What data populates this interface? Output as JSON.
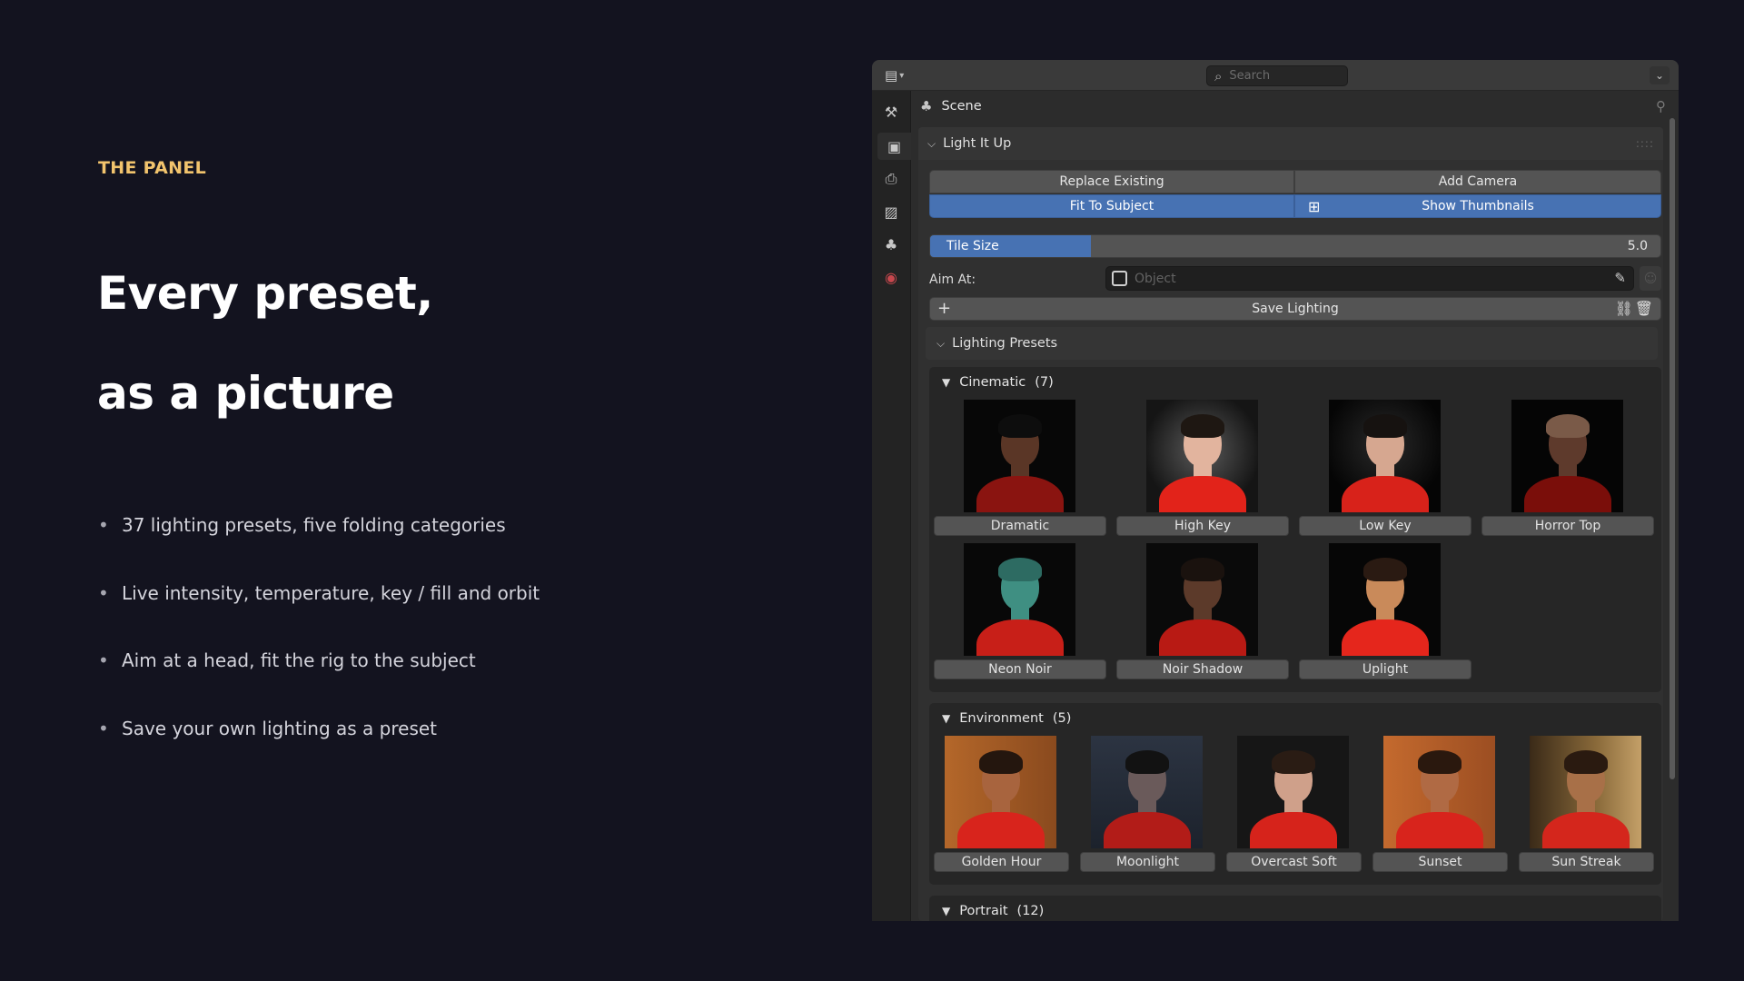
{
  "slide": {
    "eyebrow": "THE PANEL",
    "headline_line1": "Every preset,",
    "headline_line2": "as a picture",
    "bullets": [
      "37 lighting presets, five folding categories",
      "Live intensity, temperature, key / fill and orbit",
      "Aim at a head, fit the rig to the subject",
      "Save your own lighting as a preset"
    ]
  },
  "panel": {
    "search_placeholder": "Search",
    "context_label": "Scene",
    "addon_title": "Light It Up",
    "buttons": {
      "replace_existing": "Replace Existing",
      "add_camera": "Add Camera",
      "fit_to_subject": "Fit To Subject",
      "show_thumbnails": "Show Thumbnails"
    },
    "tile_size": {
      "label": "Tile Size",
      "value": "5.0",
      "fraction": 0.22
    },
    "aim_at": {
      "label": "Aim At:",
      "placeholder": "Object"
    },
    "save_lighting": "Save Lighting",
    "presets_title": "Lighting Presets",
    "categories": [
      {
        "name": "Cinematic",
        "count": "(7)",
        "presets": [
          "Dramatic",
          "High Key",
          "Low Key",
          "Horror Top",
          "Neon Noir",
          "Noir Shadow",
          "Uplight"
        ]
      },
      {
        "name": "Environment",
        "count": "(5)",
        "presets": [
          "Golden Hour",
          "Moonlight",
          "Overcast Soft",
          "Sunset",
          "Sun Streak"
        ]
      },
      {
        "name": "Portrait",
        "count": "(12)",
        "presets": []
      }
    ]
  },
  "colors": {
    "background": "#13131f",
    "accent_yellow": "#f2c46d",
    "blender_blue": "#4772b3",
    "shirt_red": "#d8241c"
  }
}
